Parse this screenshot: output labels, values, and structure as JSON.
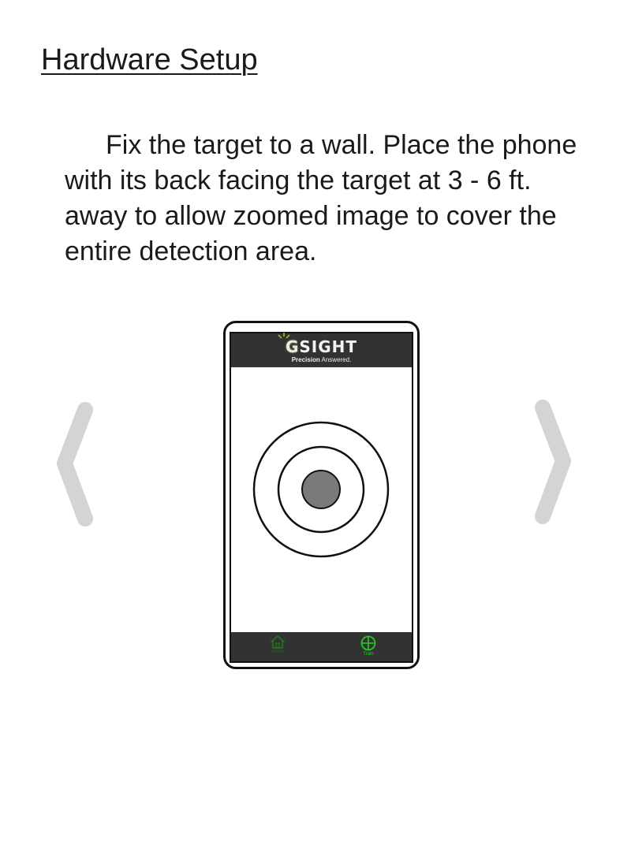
{
  "page": {
    "title": "Hardware Setup",
    "instructions": "Fix the target to a wall. Place the phone with its back facing the target at 3 - 6 ft. away to allow zoomed image to cover the entire detection area."
  },
  "phone_illustration": {
    "brand_g": "G",
    "brand_rest": "SIGHT",
    "tagline_bold": "Precision",
    "tagline_rest": " Answered.",
    "tabs": [
      {
        "label": "Home",
        "icon": "home-icon",
        "active": false
      },
      {
        "label": "Train",
        "icon": "crosshair-icon",
        "active": true
      }
    ]
  },
  "colors": {
    "arrow": "#d4d4d4",
    "phone_bar": "#333233",
    "active_tab": "#22cc22",
    "inactive_tab": "#1f5f1f",
    "bullseye": "#7a7a7a"
  }
}
